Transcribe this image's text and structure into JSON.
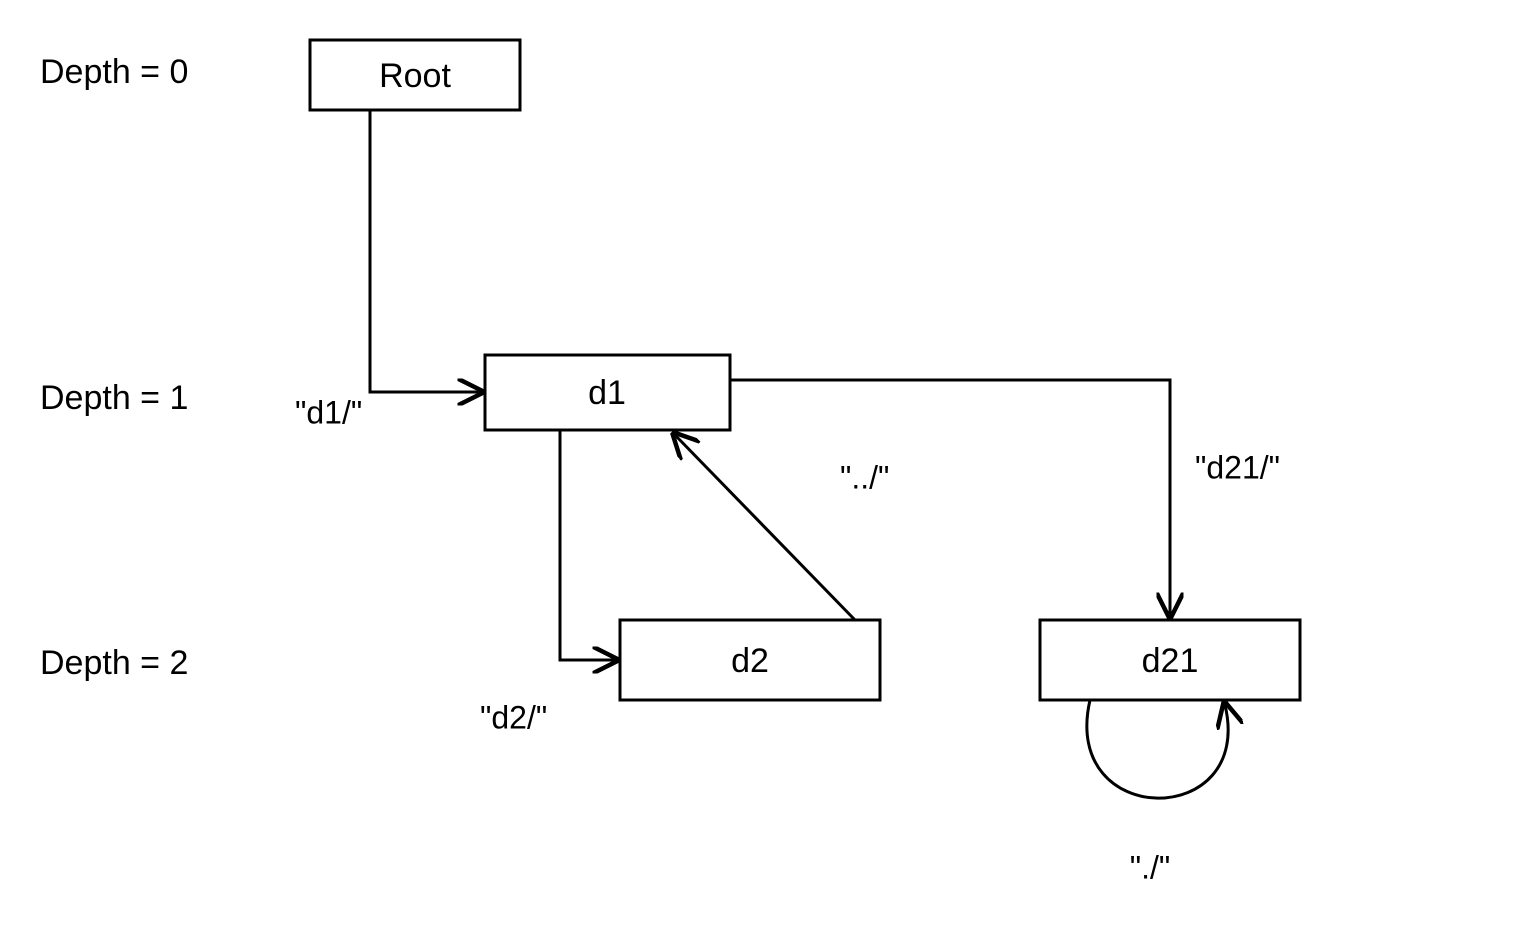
{
  "depth_labels": {
    "d0": "Depth = 0",
    "d1": "Depth = 1",
    "d2": "Depth = 2"
  },
  "nodes": {
    "root": "Root",
    "d1": "d1",
    "d2": "d2",
    "d21": "d21"
  },
  "edges": {
    "root_to_d1": "\"d1/\"",
    "d1_to_d2": "\"d2/\"",
    "d1_to_d21": "\"d21/\"",
    "d2_to_d1": "\"../\"",
    "d21_self": "\"./\""
  }
}
